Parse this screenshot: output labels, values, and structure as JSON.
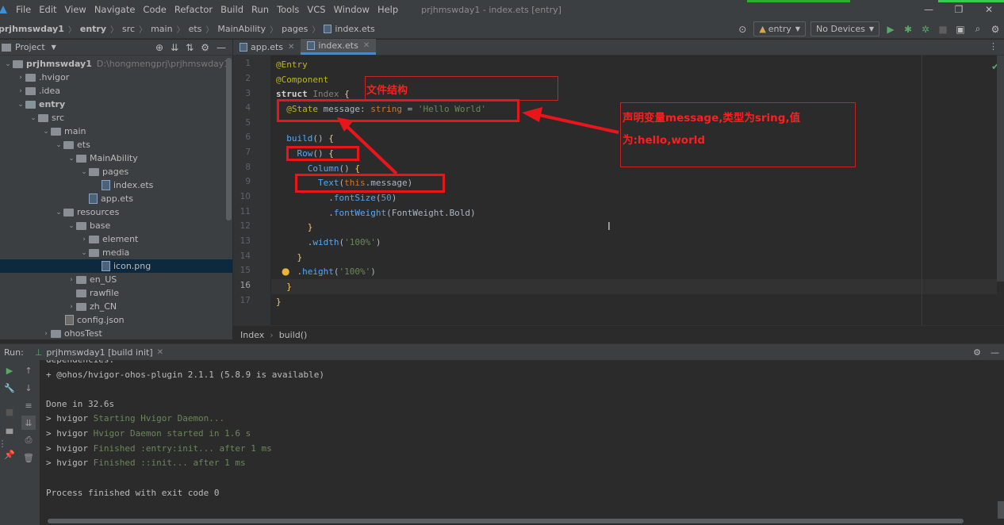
{
  "menubar": {
    "items": [
      "File",
      "Edit",
      "View",
      "Navigate",
      "Code",
      "Refactor",
      "Build",
      "Run",
      "Tools",
      "VCS",
      "Window",
      "Help"
    ],
    "title": "prjhmswday1 - index.ets [entry]"
  },
  "navbar": {
    "crumbs": [
      "prjhmswday1",
      "entry",
      "src",
      "main",
      "ets",
      "MainAbility",
      "pages",
      "index.ets"
    ]
  },
  "toolbar": {
    "config": "entry",
    "devices": "No Devices"
  },
  "project": {
    "header": "Project",
    "tree": [
      {
        "label": "prjhmswday1",
        "path": "D:\\hongmengprj\\prjhmswday1"
      },
      {
        "label": ".hvigor"
      },
      {
        "label": ".idea"
      },
      {
        "label": "entry"
      },
      {
        "label": "src"
      },
      {
        "label": "main"
      },
      {
        "label": "ets"
      },
      {
        "label": "MainAbility"
      },
      {
        "label": "pages"
      },
      {
        "label": "index.ets"
      },
      {
        "label": "app.ets"
      },
      {
        "label": "resources"
      },
      {
        "label": "base"
      },
      {
        "label": "element"
      },
      {
        "label": "media"
      },
      {
        "label": "icon.png"
      },
      {
        "label": "en_US"
      },
      {
        "label": "rawfile"
      },
      {
        "label": "zh_CN"
      },
      {
        "label": "config.json"
      },
      {
        "label": "ohosTest"
      }
    ]
  },
  "editor": {
    "tabs": [
      "app.ets",
      "index.ets"
    ],
    "line_numbers": [
      "1",
      "2",
      "3",
      "4",
      "5",
      "6",
      "7",
      "8",
      "9",
      "10",
      "11",
      "12",
      "13",
      "14",
      "15",
      "16",
      "17"
    ],
    "breadcrumb": [
      "Index",
      "build()"
    ]
  },
  "annotations": {
    "file_structure": "文件结构",
    "declare_line1": "声明变量message,类型为sring,值",
    "declare_line2": "为:hello,world"
  },
  "run": {
    "label": "Run:",
    "tab": "prjhmswday1 [build init]",
    "lines": [
      {
        "text": "dependencies:"
      },
      {
        "text": "+ @ohos/hvigor-ohos-plugin 2.1.1 (5.8.9 is available)"
      },
      {
        "text": ""
      },
      {
        "text": "Done in 32.6s"
      },
      {
        "prefix": "> hvigor ",
        "green": "Starting Hvigor Daemon..."
      },
      {
        "prefix": "> hvigor ",
        "green": "Hvigor Daemon started in 1.6 s"
      },
      {
        "prefix": "> hvigor ",
        "green": "Finished :entry:init... after 1 ms"
      },
      {
        "prefix": "> hvigor ",
        "green": "Finished ::init... after 1 ms"
      },
      {
        "text": ""
      },
      {
        "text": "Process finished with exit code 0"
      }
    ]
  }
}
